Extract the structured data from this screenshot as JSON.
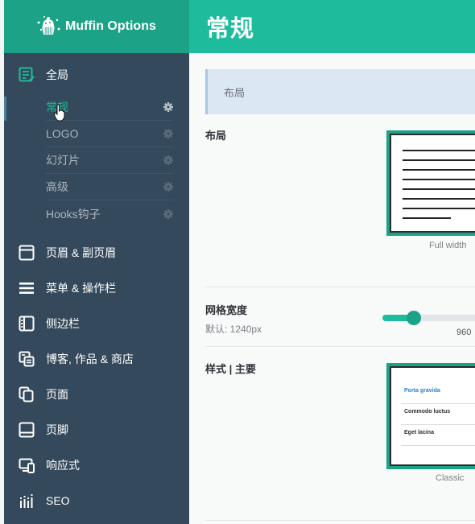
{
  "app": {
    "brand": "Muffin Options",
    "page_title": "常规"
  },
  "sidebar": {
    "global_label": "全局",
    "sub_items": [
      {
        "label": "常规",
        "active": true
      },
      {
        "label": "LOGO",
        "active": false
      },
      {
        "label": "幻灯片",
        "active": false
      },
      {
        "label": "高级",
        "active": false
      },
      {
        "label": "Hooks钩子",
        "active": false
      }
    ],
    "items": [
      {
        "label": "页眉 & 副页眉",
        "icon": "window-icon"
      },
      {
        "label": "菜单 & 操作栏",
        "icon": "menu-icon"
      },
      {
        "label": "侧边栏",
        "icon": "sidebar-icon"
      },
      {
        "label": "博客, 作品 & 商店",
        "icon": "blog-icon"
      },
      {
        "label": "页面",
        "icon": "pages-icon"
      },
      {
        "label": "页脚",
        "icon": "footer-icon"
      },
      {
        "label": "响应式",
        "icon": "responsive-icon"
      },
      {
        "label": "SEO",
        "icon": "seo-icon"
      }
    ]
  },
  "main": {
    "section_heading": "布局",
    "layout": {
      "label": "布局",
      "option_caption": "Full width"
    },
    "grid_width": {
      "label": "网格宽度",
      "default_text": "默认: 1240px",
      "value": "960",
      "slider_fraction": 0.3
    },
    "style": {
      "label": "样式 | 主要",
      "option_caption": "Classic",
      "sample_items": [
        "Porta gravida",
        "Commodo luctus",
        "Eget lacina"
      ]
    }
  },
  "colors": {
    "accent": "#1dbc9c",
    "accent_dark": "#1ca287",
    "sidebar_bg": "#344a5c",
    "section_bar_bg": "#dce7f4"
  }
}
